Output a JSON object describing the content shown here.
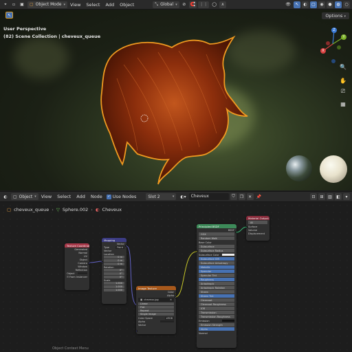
{
  "top_header": {
    "mode": "Object Mode",
    "menus": [
      "View",
      "Select",
      "Add",
      "Object"
    ],
    "orientation": "Global",
    "options_label": "Options"
  },
  "viewport": {
    "perspective": "User Perspective",
    "collection": "(82) Scene Collection | cheveux_queue",
    "gizmo": {
      "z": "Z",
      "y": "Y",
      "x": "X"
    }
  },
  "node_header": {
    "mode": "Object",
    "menus": [
      "View",
      "Select",
      "Add",
      "Node"
    ],
    "use_nodes_label": "Use Nodes",
    "slot": "Slot 2",
    "material": "Cheveux"
  },
  "breadcrumb": {
    "object": "cheveux_queue",
    "mesh": "Sphere.002",
    "material": "Cheveux"
  },
  "nodes": {
    "texcoord": {
      "title": "Texture Coordinate",
      "outputs": [
        "Generated",
        "Normal",
        "UV",
        "Object",
        "Camera",
        "Window",
        "Reflection"
      ],
      "object_label": "Object",
      "from_instancer": "From Instancer"
    },
    "mapping": {
      "title": "Mapping",
      "vector_out": "Vector",
      "type_label": "Type",
      "type_value": "Point",
      "vector_in": "Vector",
      "location": "Location",
      "rotation": "Rotation",
      "scale": "Scale",
      "loc_vals": [
        "0 m",
        "0 m",
        "0 m"
      ],
      "rot_vals": [
        "0°",
        "0°",
        "0°"
      ],
      "scale_vals": [
        "1.000",
        "1.000",
        "1.000"
      ]
    },
    "image": {
      "title": "Image Texture",
      "image_name": "cheveux.jpg",
      "outputs": [
        "Color",
        "Alpha"
      ],
      "interp": "Linear",
      "proj": "Flat",
      "ext": "Repeat",
      "source": "Single Image",
      "colorspace_label": "Color Space",
      "colorspace": "sRGB",
      "alpha_label": "Alpha",
      "vector": "Vector"
    },
    "bsdf": {
      "title": "Principled BSDF",
      "out": "BSDF",
      "rows": [
        "GGX",
        "Random Walk",
        "Base Color",
        "Subsurface",
        "Subsurface Radius",
        "Subsurface Color",
        "Subsurface IOR",
        "Subsurface Anisotropy",
        "Metallic",
        "Specular",
        "Specular Tint",
        "Roughness",
        "Anisotropic",
        "Anisotropic Rotation",
        "Sheen",
        "Sheen Tint",
        "Clearcoat",
        "Clearcoat Roughness",
        "IOR",
        "Transmission",
        "Transmission Roughness",
        "Emission",
        "Emission Strength",
        "Alpha",
        "Normal"
      ]
    },
    "output": {
      "title": "Material Output",
      "target": "All",
      "inputs": [
        "Surface",
        "Volume",
        "Displacement"
      ]
    }
  },
  "status_text": "Object Context Menu"
}
